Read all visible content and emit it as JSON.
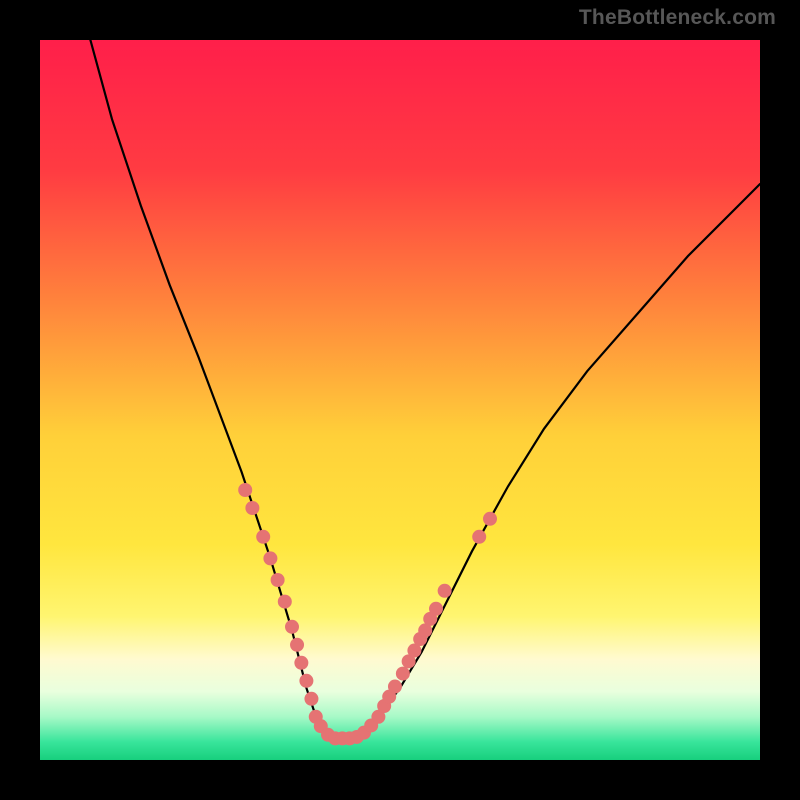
{
  "watermark": {
    "text": "TheBottleneck.com"
  },
  "colors": {
    "gradient_stops": [
      {
        "offset": 0.0,
        "color": "#ff1f4a"
      },
      {
        "offset": 0.18,
        "color": "#ff3b42"
      },
      {
        "offset": 0.36,
        "color": "#ff823c"
      },
      {
        "offset": 0.55,
        "color": "#ffd039"
      },
      {
        "offset": 0.7,
        "color": "#ffe63e"
      },
      {
        "offset": 0.8,
        "color": "#fff570"
      },
      {
        "offset": 0.86,
        "color": "#fffad0"
      },
      {
        "offset": 0.905,
        "color": "#e9ffde"
      },
      {
        "offset": 0.94,
        "color": "#a7f9c7"
      },
      {
        "offset": 0.975,
        "color": "#38e59b"
      },
      {
        "offset": 1.0,
        "color": "#17cf7d"
      }
    ],
    "curve_color": "#000000",
    "marker_color": "#e57373",
    "background": "#000000"
  },
  "chart_data": {
    "type": "line",
    "title": "",
    "xlabel": "",
    "ylabel": "",
    "xlim": [
      0,
      100
    ],
    "ylim": [
      0,
      100
    ],
    "grid": false,
    "series": [
      {
        "name": "curve",
        "x": [
          7,
          10,
          14,
          18,
          22,
          25,
          28,
          30,
          32,
          33.5,
          35,
          36,
          37,
          38,
          39,
          40,
          41,
          43,
          45,
          47,
          50,
          53,
          56,
          60,
          65,
          70,
          76,
          83,
          90,
          97,
          100
        ],
        "y": [
          100,
          89,
          77,
          66,
          56,
          48,
          40,
          34,
          28,
          23,
          18,
          14,
          10,
          7,
          5,
          3.5,
          3,
          3,
          4,
          6,
          10,
          15,
          21,
          29,
          38,
          46,
          54,
          62,
          70,
          77,
          80
        ]
      }
    ],
    "markers": [
      {
        "x": 28.5,
        "y": 37.5
      },
      {
        "x": 29.5,
        "y": 35.0
      },
      {
        "x": 31.0,
        "y": 31.0
      },
      {
        "x": 32.0,
        "y": 28.0
      },
      {
        "x": 33.0,
        "y": 25.0
      },
      {
        "x": 34.0,
        "y": 22.0
      },
      {
        "x": 35.0,
        "y": 18.5
      },
      {
        "x": 35.7,
        "y": 16.0
      },
      {
        "x": 36.3,
        "y": 13.5
      },
      {
        "x": 37.0,
        "y": 11.0
      },
      {
        "x": 37.7,
        "y": 8.5
      },
      {
        "x": 38.3,
        "y": 6.0
      },
      {
        "x": 39.0,
        "y": 4.7
      },
      {
        "x": 40.0,
        "y": 3.5
      },
      {
        "x": 41.0,
        "y": 3.0
      },
      {
        "x": 42.0,
        "y": 3.0
      },
      {
        "x": 43.0,
        "y": 3.0
      },
      {
        "x": 44.0,
        "y": 3.2
      },
      {
        "x": 45.0,
        "y": 3.8
      },
      {
        "x": 46.0,
        "y": 4.8
      },
      {
        "x": 47.0,
        "y": 6.0
      },
      {
        "x": 47.8,
        "y": 7.5
      },
      {
        "x": 48.5,
        "y": 8.8
      },
      {
        "x": 49.3,
        "y": 10.2
      },
      {
        "x": 50.4,
        "y": 12.0
      },
      {
        "x": 51.2,
        "y": 13.7
      },
      {
        "x": 52.0,
        "y": 15.2
      },
      {
        "x": 52.8,
        "y": 16.8
      },
      {
        "x": 53.5,
        "y": 18.0
      },
      {
        "x": 54.2,
        "y": 19.6
      },
      {
        "x": 55.0,
        "y": 21.0
      },
      {
        "x": 56.2,
        "y": 23.5
      },
      {
        "x": 61.0,
        "y": 31.0
      },
      {
        "x": 62.5,
        "y": 33.5
      }
    ],
    "marker_radius_px": 7
  }
}
